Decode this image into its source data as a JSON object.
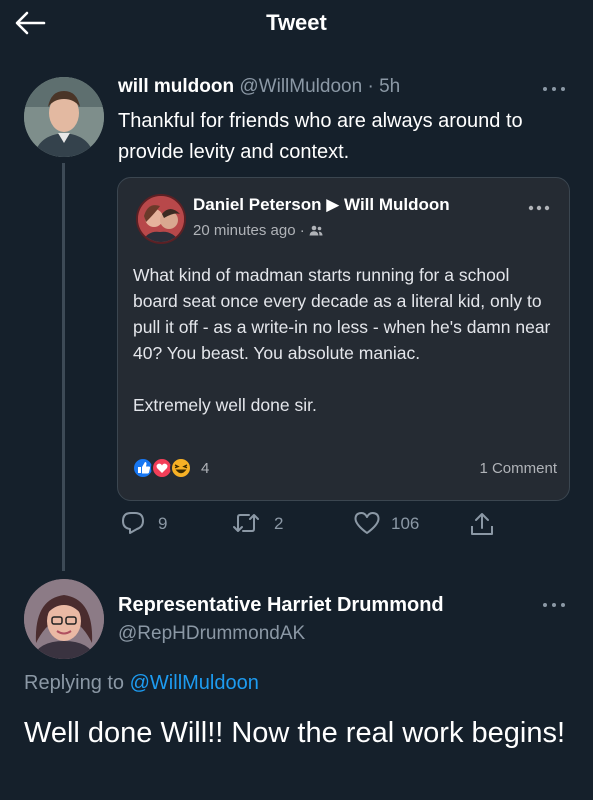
{
  "header": {
    "title": "Tweet",
    "back_icon": "arrow-left-icon"
  },
  "tweet": {
    "author_name": "will muldoon",
    "author_handle": "@WillMuldoon",
    "separator": " · ",
    "time": "5h",
    "text": "Thankful for friends who are always around to provide levity and context.",
    "embed": {
      "poster": "Daniel Peterson",
      "arrow": "▶",
      "recipient": "Will Muldoon",
      "time": "20 minutes ago",
      "audience_separator": " · ",
      "body_paragraph_1": "What kind of madman starts running for a school board seat once every decade as a literal kid, only to pull it off - as a write-in no less - when he's damn near 40? You beast. You absolute maniac.",
      "body_paragraph_2": "Extremely well done sir.",
      "reaction_count": "4",
      "comments": "1 Comment"
    },
    "actions": {
      "replies": "9",
      "retweets": "2",
      "likes": "106"
    }
  },
  "reply": {
    "author_name": "Representative Harriet Drummond",
    "author_handle": "@RepHDrummondAK",
    "replying_prefix": "Replying to ",
    "replying_handle": "@WillMuldoon",
    "text": "Well done Will!! Now the real work begins!"
  },
  "colors": {
    "background": "#15202b",
    "muted": "#8b98a5",
    "link": "#1d9bf0",
    "embed_bg": "#252b33",
    "like_blue": "#1877f2",
    "love_red": "#f33e58",
    "haha_yellow": "#f7b125"
  }
}
